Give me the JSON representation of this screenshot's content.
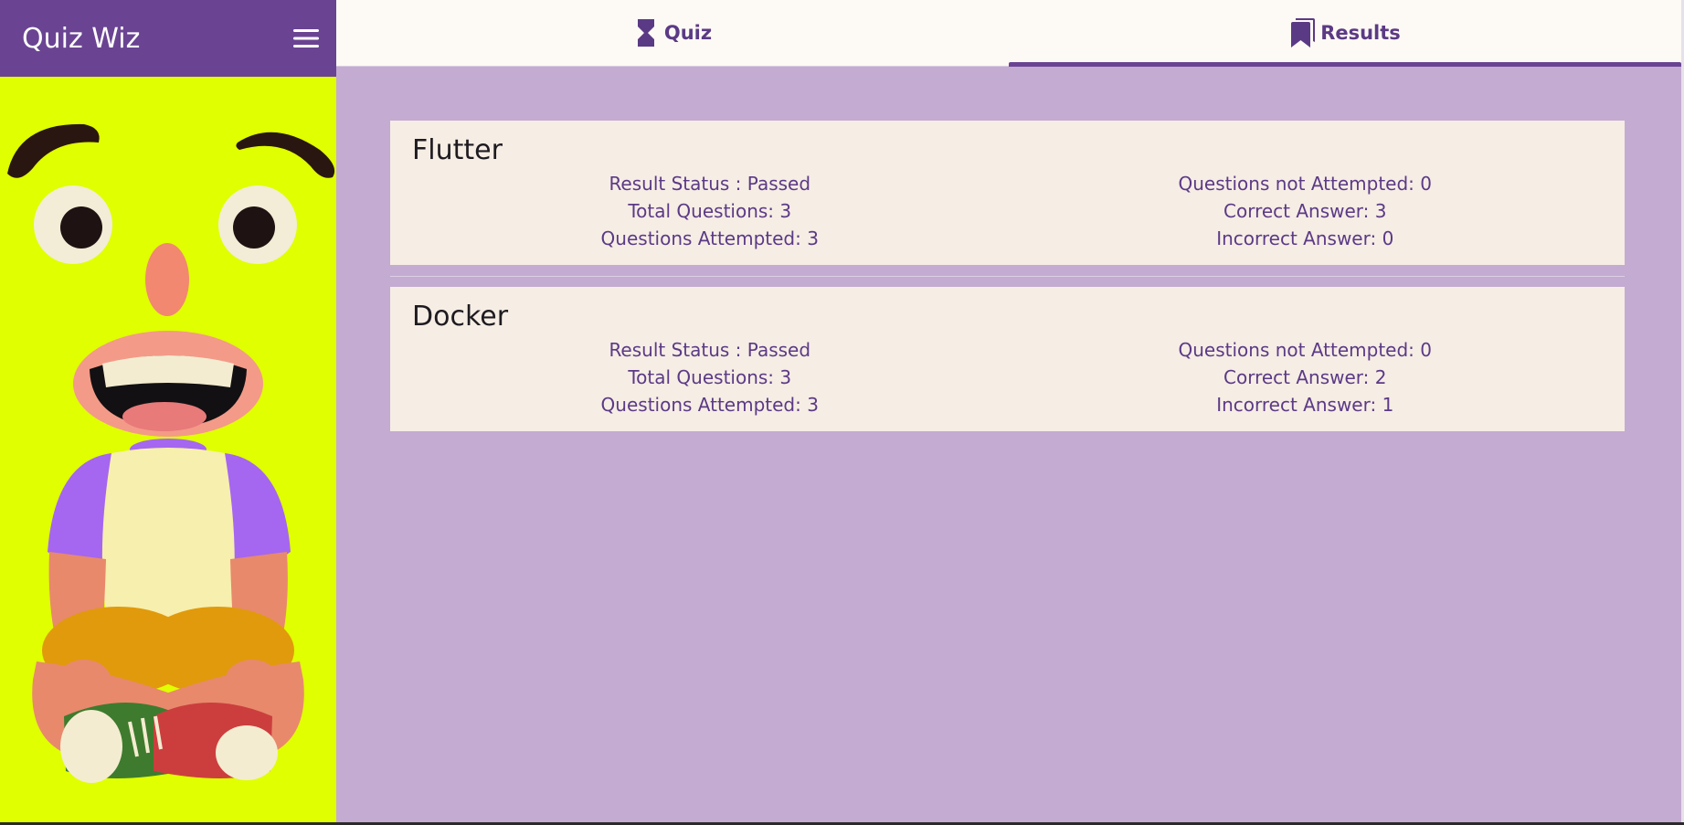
{
  "app": {
    "title": "Quiz Wiz"
  },
  "tabs": [
    {
      "label": "Quiz",
      "icon": "hourglass-icon",
      "active": false
    },
    {
      "label": "Results",
      "icon": "bookmarks-icon",
      "active": true
    }
  ],
  "colors": {
    "primary": "#6a4492",
    "sidebar_bg": "#e0ff00",
    "content_bg": "#c4abd2",
    "card_bg": "#f6ede5",
    "text_accent": "#5b3a85"
  },
  "results": [
    {
      "title": "Flutter",
      "left": [
        "Result Status : Passed",
        "Total Questions: 3",
        "Questions Attempted: 3"
      ],
      "right": [
        "Questions not Attempted: 0",
        "Correct Answer: 3",
        "Incorrect Answer: 0"
      ]
    },
    {
      "title": "Docker",
      "left": [
        "Result Status : Passed",
        "Total Questions: 3",
        "Questions Attempted: 3"
      ],
      "right": [
        "Questions not Attempted: 0",
        "Correct Answer: 2",
        "Incorrect Answer: 1"
      ]
    }
  ]
}
